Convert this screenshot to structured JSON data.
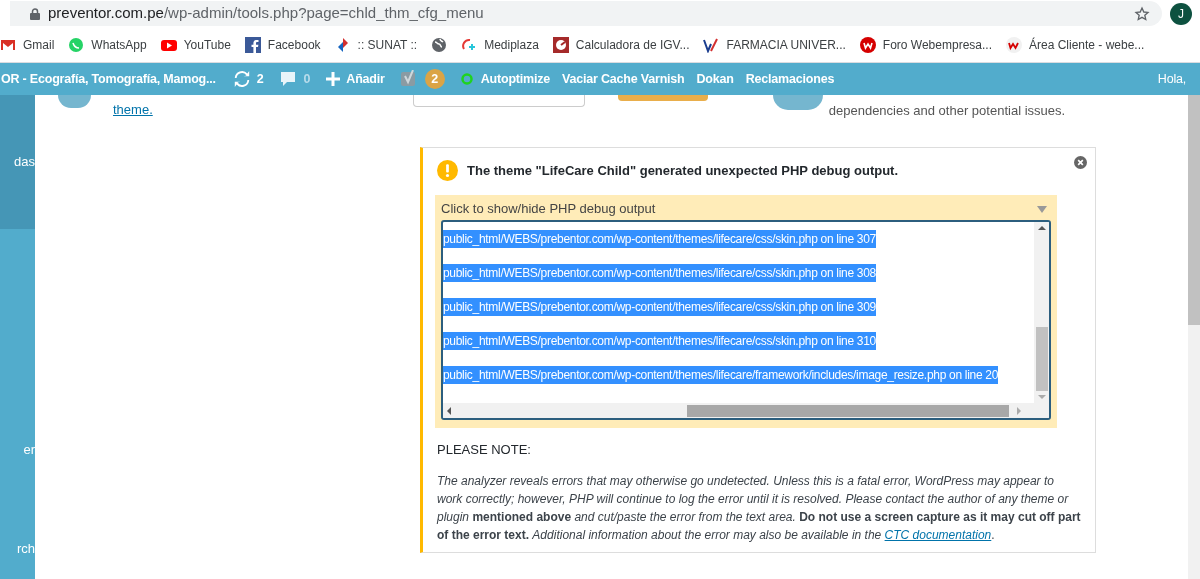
{
  "browser": {
    "url_host": "preventor.com.pe",
    "url_path": "/wp-admin/tools.php?page=chld_thm_cfg_menu",
    "profile": "J"
  },
  "bookmarks": [
    {
      "kind": "link",
      "label": "Gmail"
    },
    {
      "kind": "link",
      "label": "WhatsApp"
    },
    {
      "kind": "link",
      "label": "YouTube"
    },
    {
      "kind": "link",
      "label": "Facebook"
    },
    {
      "kind": "link",
      "label": ":: SUNAT ::"
    },
    {
      "kind": "icon"
    },
    {
      "kind": "link",
      "label": "Mediplaza"
    },
    {
      "kind": "link",
      "label": "Calculadora de IGV..."
    },
    {
      "kind": "link",
      "label": "FARMACIA UNIVER..."
    },
    {
      "kind": "link",
      "label": "Foro Webempresa..."
    },
    {
      "kind": "link",
      "label": "Área Cliente - webe..."
    }
  ],
  "admin_bar": {
    "site": "OR - Ecografía, Tomografía, Mamog...",
    "updates": "2",
    "comments": "0",
    "add": "Añadir",
    "seo_badge": "2",
    "autoptimize": "Autoptimize",
    "links": [
      "Vaciar Cache Varnish",
      "Dokan",
      "Reclamaciones"
    ],
    "greeting": "Hola,"
  },
  "sidebar": {
    "items": [
      {
        "label": "das",
        "selected": true
      },
      {
        "label": "er",
        "selected": false
      },
      {
        "label": "rch",
        "selected": false
      }
    ]
  },
  "top": {
    "backup_link": "theme.",
    "analyze_text": "dependencies and other potential issues."
  },
  "notice": {
    "message": "The theme \"LifeCare Child\" generated unexpected PHP debug output.",
    "toggle": "Click to show/hide PHP debug output",
    "expanded": true,
    "output_lines": [
      "public_html/WEBS/prebentor.com/wp-content/themes/lifecare/css/skin.php on line 307",
      "public_html/WEBS/prebentor.com/wp-content/themes/lifecare/css/skin.php on line 308",
      "public_html/WEBS/prebentor.com/wp-content/themes/lifecare/css/skin.php on line 309",
      "public_html/WEBS/prebentor.com/wp-content/themes/lifecare/css/skin.php on line 310",
      "public_html/WEBS/prebentor.com/wp-content/themes/lifecare/framework/includes/image_resize.php on line 20"
    ],
    "note_heading": "PLEASE NOTE:",
    "note_text": "*The analyzer reveals errors that may otherwise go undetected. Unless this is a fatal error, WordPress may appear to work correctly; however, PHP will continue to log the error until it is resolved. Please contact the author of any theme or plugin* **mentioned above** *and cut/paste the error from the text area.* **Do not use a screen capture as it may cut off part of the error text.** *Additional information about the error may also be available in the*",
    "note_link": "CTC documentation",
    "note_end": "."
  }
}
